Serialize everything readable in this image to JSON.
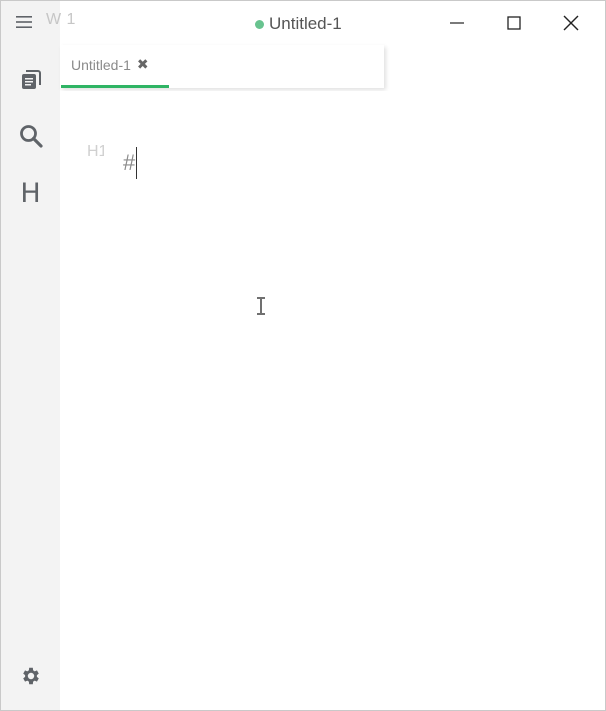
{
  "titlebar": {
    "word_count": "W 1",
    "title": "Untitled-1",
    "unsaved_color": "#68c38f"
  },
  "sidebar": {
    "items": [
      {
        "name": "menu",
        "icon": "hamburger-icon"
      },
      {
        "name": "files",
        "icon": "files-icon"
      },
      {
        "name": "search",
        "icon": "search-icon"
      },
      {
        "name": "toc",
        "icon": "heading-icon",
        "glyph": "H"
      },
      {
        "name": "settings",
        "icon": "gear-icon"
      }
    ]
  },
  "tabs": [
    {
      "label": "Untitled-1",
      "active": true,
      "close_glyph": "✖"
    }
  ],
  "editor": {
    "heading_marker": "H1",
    "text": "#",
    "accent_color": "#2fb464"
  },
  "window_controls": [
    "minimize",
    "maximize",
    "close"
  ]
}
